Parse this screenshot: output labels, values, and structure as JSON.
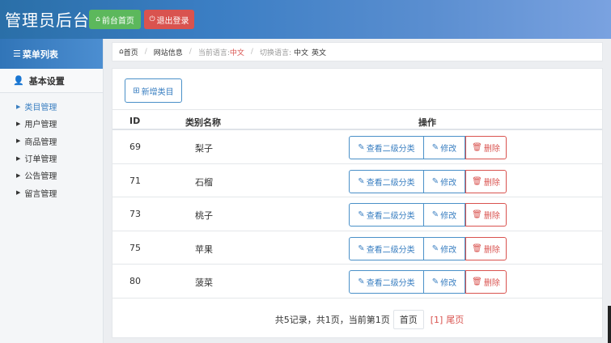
{
  "header": {
    "title": "管理员后台",
    "home_button": "前台首页",
    "logout_button": "退出登录"
  },
  "sidebar": {
    "heading": "菜单列表",
    "group": "基本设置",
    "items": [
      {
        "label": "类目管理",
        "active": true
      },
      {
        "label": "用户管理",
        "active": false
      },
      {
        "label": "商品管理",
        "active": false
      },
      {
        "label": "订单管理",
        "active": false
      },
      {
        "label": "公告管理",
        "active": false
      },
      {
        "label": "留言管理",
        "active": false
      }
    ]
  },
  "breadcrumb": {
    "home": "首页",
    "site_info": "网站信息",
    "current_lang_label": "当前语言:",
    "current_lang": "中文",
    "switch_lang_label": "切换语言:",
    "lang_zh": "中文",
    "lang_en": "英文"
  },
  "main": {
    "add_button": "新增类目",
    "columns": {
      "id": "ID",
      "name": "类别名称",
      "ops": "操作"
    },
    "row_actions": {
      "view": "查看二级分类",
      "edit": "修改",
      "delete": "删除"
    },
    "rows": [
      {
        "id": "69",
        "name": "梨子"
      },
      {
        "id": "71",
        "name": "石榴"
      },
      {
        "id": "73",
        "name": "桃子"
      },
      {
        "id": "75",
        "name": "苹果"
      },
      {
        "id": "80",
        "name": "菠菜"
      }
    ],
    "pager": {
      "summary": "共5记录，共1页，当前第1页",
      "first": "首页",
      "current": "[1]",
      "last": "尾页"
    }
  },
  "colors": {
    "primary": "#3a7fc1",
    "success": "#5cb85c",
    "danger": "#d9534f"
  }
}
